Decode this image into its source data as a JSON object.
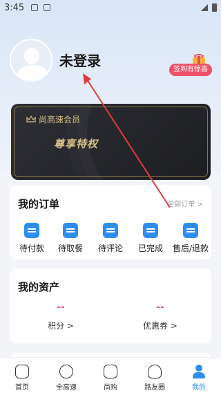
{
  "status_bar": {
    "time": "3:45"
  },
  "profile": {
    "username": "未登录",
    "sign_in_label": "签到有惊喜"
  },
  "member": {
    "title": "尚高速会员",
    "slogan": "尊享特权"
  },
  "orders": {
    "title": "我的订单",
    "all_label": "全部订单 >",
    "items": [
      {
        "label": "待付款",
        "icon": "wallet-icon"
      },
      {
        "label": "待取餐",
        "icon": "bag-icon"
      },
      {
        "label": "待评论",
        "icon": "comment-icon"
      },
      {
        "label": "已完成",
        "icon": "done-icon"
      },
      {
        "label": "售后/退款",
        "icon": "refund-icon"
      }
    ]
  },
  "assets": {
    "title": "我的资产",
    "items": [
      {
        "value": "--",
        "label": "积分 >"
      },
      {
        "value": "--",
        "label": "优惠券 >"
      }
    ]
  },
  "tabbar": {
    "items": [
      {
        "label": "首页",
        "icon": "home-icon"
      },
      {
        "label": "全高速",
        "icon": "road-icon"
      },
      {
        "label": "尚购",
        "icon": "shopping-bag-icon"
      },
      {
        "label": "路友圈",
        "icon": "community-icon"
      },
      {
        "label": "我的",
        "icon": "person-icon",
        "active": true
      }
    ]
  },
  "colors": {
    "accent": "#2e8ef0",
    "brand_pink": "#f0516a",
    "gold": "#d9c08a"
  }
}
